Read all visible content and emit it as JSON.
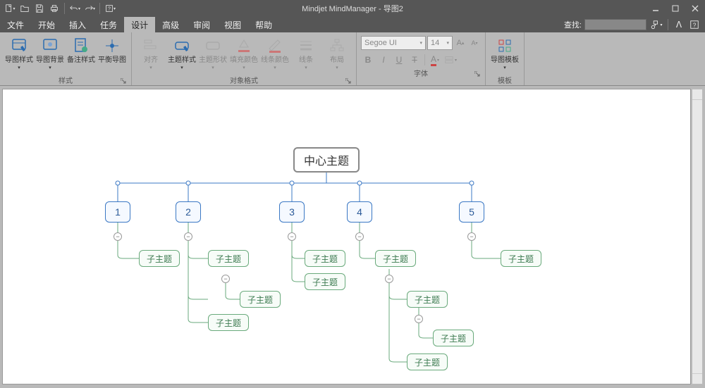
{
  "title": "Mindjet MindManager - 导图2",
  "menu": {
    "items": [
      "文件",
      "开始",
      "插入",
      "任务",
      "设计",
      "高级",
      "审阅",
      "视图",
      "帮助"
    ],
    "active_index": 4,
    "search_label": "查找:"
  },
  "ribbon": {
    "groups": {
      "style": {
        "label": "样式",
        "buttons": {
          "map_style": "导图样式",
          "map_bg": "导图背景",
          "note_style": "备注样式",
          "balance": "平衡导图"
        }
      },
      "obj_format": {
        "label": "对象格式",
        "buttons": {
          "align": "对齐",
          "topic_style": "主题样式",
          "topic_shape": "主题形状",
          "fill_color": "填充颜色",
          "line_color": "线条颜色",
          "lines": "线条",
          "layout": "布局"
        }
      },
      "font": {
        "label": "字体",
        "font_name": "Segoe UI",
        "font_size": "14"
      },
      "template": {
        "label": "模板",
        "buttons": {
          "map_template": "导图模板"
        }
      }
    }
  },
  "mindmap": {
    "center": "中心主题",
    "mains": [
      "1",
      "2",
      "3",
      "4",
      "5"
    ],
    "sub_label": "子主题"
  }
}
